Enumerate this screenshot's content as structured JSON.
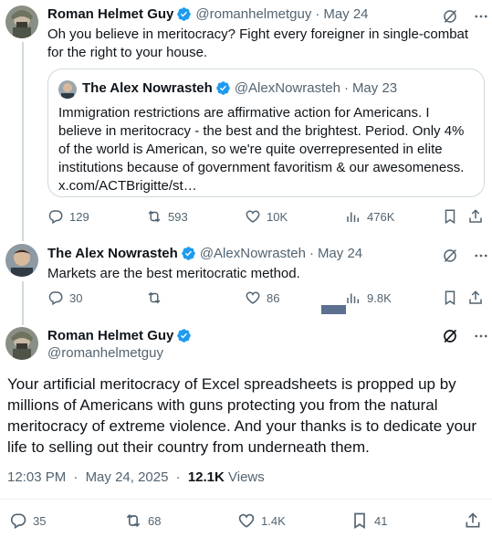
{
  "colors": {
    "verified": "#1d9bf0",
    "text": "#0f1419",
    "muted": "#536471",
    "border": "#cfd9de"
  },
  "tweet1": {
    "name": "Roman Helmet Guy",
    "handle": "@romanhelmetguy",
    "separator": "·",
    "date": "May 24",
    "text": "Oh you believe in meritocracy? Fight every foreigner in single-combat for the right to your house.",
    "icons": {
      "verified": "verified-badge-icon",
      "grok": "grok-icon",
      "more": "more-icon"
    },
    "quote": {
      "name": "The Alex Nowrasteh",
      "handle": "@AlexNowrasteh",
      "separator": "·",
      "date": "May 23",
      "text": "Immigration restrictions are affirmative action for Americans. I believe in meritocracy - the best and the brightest. Period. Only 4% of the world is American, so we're quite overrepresented in elite institutions because of government favoritism & our awesomeness. x.com/ACTBrigitte/st…"
    },
    "stats": {
      "replies": "129",
      "reposts": "593",
      "likes": "10K",
      "views": "476K"
    }
  },
  "tweet2": {
    "name": "The Alex Nowrasteh",
    "handle": "@AlexNowrasteh",
    "separator": "·",
    "date": "May 24",
    "text": "Markets are the best meritocratic method.",
    "stats": {
      "replies": "30",
      "reposts": "",
      "likes": "86",
      "views": "9.8K"
    }
  },
  "tweet3": {
    "name": "Roman Helmet Guy",
    "handle": "@romanhelmetguy",
    "text": "Your artificial meritocracy of Excel spreadsheets is propped up by millions of Americans with guns protecting you from the natural meritocracy of extreme violence. And your thanks is to dedicate your life to selling out their country from underneath them.",
    "time": "12:03 PM",
    "separator": "·",
    "date": "May 24, 2025",
    "views_count": "12.1K",
    "views_label": "Views",
    "stats": {
      "replies": "35",
      "reposts": "68",
      "likes": "1.4K",
      "bookmarks": "41"
    }
  }
}
